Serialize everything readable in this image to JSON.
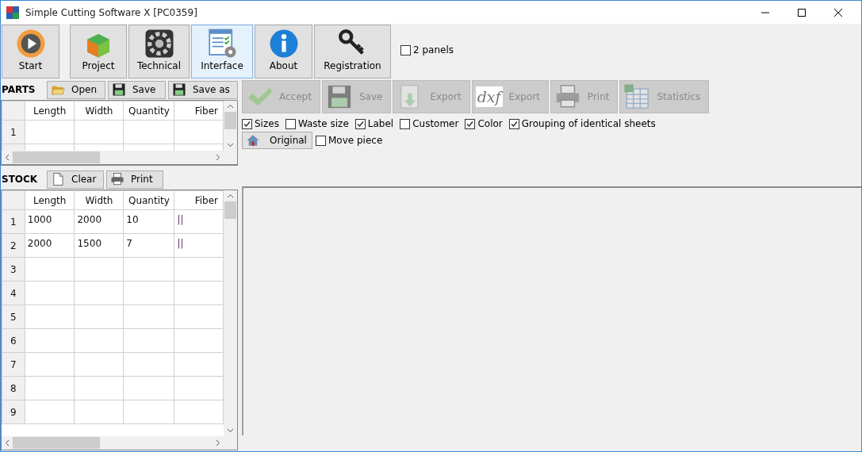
{
  "window": {
    "title": "Simple Cutting Software X [PC0359]"
  },
  "toolbar": [
    {
      "label": "Start",
      "kind": "start",
      "selected": false
    },
    {
      "label": "Project",
      "kind": "project",
      "selected": false
    },
    {
      "label": "Technical",
      "kind": "technical",
      "selected": false
    },
    {
      "label": "Interface",
      "kind": "interface",
      "selected": true
    },
    {
      "label": "About",
      "kind": "about",
      "selected": false
    },
    {
      "label": "Registration",
      "kind": "registration",
      "selected": false
    }
  ],
  "two_panels": {
    "label": "2 panels",
    "checked": false
  },
  "parts": {
    "title": "PARTS",
    "buttons": [
      {
        "label": "Open",
        "kind": "open"
      },
      {
        "label": "Save",
        "kind": "save"
      },
      {
        "label": "Save as",
        "kind": "save"
      }
    ],
    "table": {
      "columns": [
        "Length",
        "Width",
        "Quantity",
        "Fiber"
      ],
      "rows": [
        {
          "number": "1",
          "cells": []
        }
      ]
    }
  },
  "stock": {
    "title": "STOCK",
    "buttons": [
      {
        "label": "Clear",
        "kind": "clear"
      },
      {
        "label": "Print",
        "kind": "print"
      }
    ],
    "table": {
      "columns": [
        "Length",
        "Width",
        "Quantity",
        "Fiber"
      ],
      "rows": [
        {
          "number": "1",
          "cells": [
            "1000",
            "2000",
            "10",
            "||"
          ]
        },
        {
          "number": "2",
          "cells": [
            "2000",
            "1500",
            "7",
            "||"
          ]
        },
        {
          "number": "3",
          "cells": []
        },
        {
          "number": "4",
          "cells": []
        },
        {
          "number": "5",
          "cells": []
        },
        {
          "number": "6",
          "cells": []
        },
        {
          "number": "7",
          "cells": []
        },
        {
          "number": "8",
          "cells": []
        },
        {
          "number": "9",
          "cells": []
        }
      ]
    }
  },
  "actions": [
    {
      "label": "Accept",
      "kind": "accept",
      "disabled": true
    },
    {
      "label": "Save",
      "kind": "save",
      "disabled": true
    },
    {
      "label": "Export",
      "kind": "export",
      "disabled": true
    },
    {
      "label": "Export",
      "kind": "dxf",
      "icon_text": "dxf",
      "disabled": true
    },
    {
      "label": "Print",
      "kind": "print",
      "disabled": true
    },
    {
      "label": "Statistics",
      "kind": "statistics",
      "disabled": true
    }
  ],
  "options": [
    {
      "label": "Sizes",
      "checked": true
    },
    {
      "label": "Waste size",
      "checked": false
    },
    {
      "label": "Label",
      "checked": true
    },
    {
      "label": "Customer",
      "checked": false
    },
    {
      "label": "Color",
      "checked": true
    },
    {
      "label": "Grouping of identical sheets",
      "checked": true
    }
  ],
  "original_button": {
    "label": "Original"
  },
  "move_piece": {
    "label": "Move piece",
    "checked": false
  }
}
